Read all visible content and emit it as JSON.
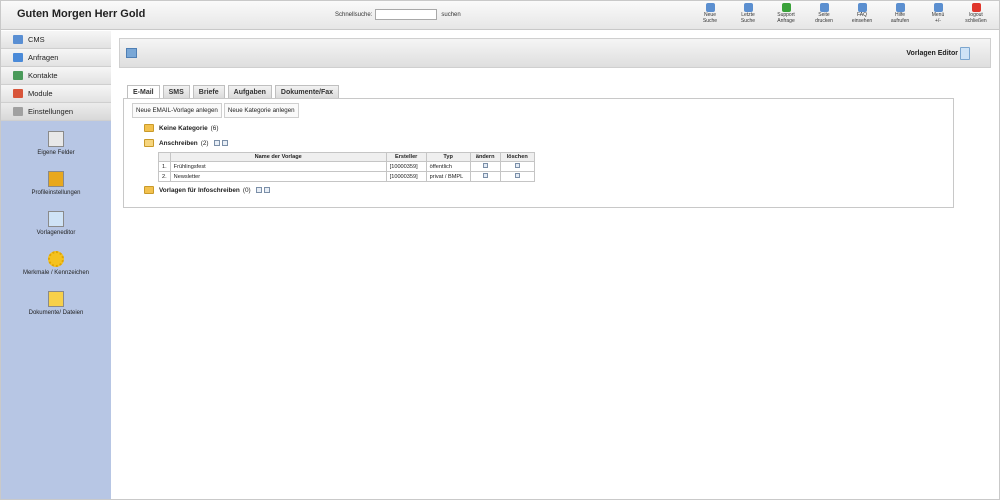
{
  "header": {
    "greeting": "Guten Morgen Herr Gold",
    "search_label": "Schnellsuche:",
    "search_value": "",
    "search_button": "suchen",
    "tools": [
      {
        "label": "Neue\nSuche",
        "icon": "search-icon",
        "color": "#5b8fd0"
      },
      {
        "label": "Letzte\nSuche",
        "icon": "history-icon",
        "color": "#5b8fd0"
      },
      {
        "label": "Support\nAnfrage",
        "icon": "support-plus-icon",
        "color": "#3aa23a"
      },
      {
        "label": "Seite\ndrucken",
        "icon": "printer-icon",
        "color": "#5b8fd0"
      },
      {
        "label": "FAQ\neinsehen",
        "icon": "faq-icon",
        "color": "#5b8fd0"
      },
      {
        "label": "Hilfe\naufrufen",
        "icon": "help-icon",
        "color": "#5b8fd0"
      },
      {
        "label": "Menü\n+/-",
        "icon": "menu-toggle-icon",
        "color": "#5b8fd0"
      },
      {
        "label": "logout\nschließen",
        "icon": "logout-icon",
        "color": "#e0362c"
      }
    ]
  },
  "sidebar": {
    "items": [
      {
        "label": "CMS",
        "icon": "cms-icon",
        "color": "#5a8fd3"
      },
      {
        "label": "Anfragen",
        "icon": "chat-icon",
        "color": "#4a8ad8"
      },
      {
        "label": "Kontakte",
        "icon": "contacts-icon",
        "color": "#4a9a5a"
      },
      {
        "label": "Module",
        "icon": "module-icon",
        "color": "#d8553a"
      },
      {
        "label": "Einstellungen",
        "icon": "settings-icon",
        "color": "#a0a0a0"
      }
    ],
    "sub_items": [
      {
        "label": "Eigene Felder",
        "icon": "fields-icon",
        "color": "#e8e8e8"
      },
      {
        "label": "Profileinstellungen",
        "icon": "profile-book-icon",
        "color": "#e8a81e"
      },
      {
        "label": "Vorlageneditor",
        "icon": "template-editor-icon",
        "color": "#cfe3f6"
      },
      {
        "label": "Merkmale / Kennzeichen",
        "icon": "sun-marker-icon",
        "color": "#f4c21f"
      },
      {
        "label": "Dokumente/ Dateien",
        "icon": "envelope-icon",
        "color": "#f7d04a"
      }
    ]
  },
  "main": {
    "title": "Vorlagen Editor",
    "tabs": [
      "E-Mail",
      "SMS",
      "Briefe",
      "Aufgaben",
      "Dokumente/Fax"
    ],
    "actions": [
      "Neue EMAIL-Vorlage anlegen",
      "Neue Kategorie anlegen"
    ],
    "categories": [
      {
        "name": "Keine Kategorie",
        "count": "(6)"
      },
      {
        "name": "Anschreiben",
        "count": "(2)"
      },
      {
        "name": "Vorlagen für Infoschreiben",
        "count": "(0)"
      }
    ],
    "table": {
      "headers": [
        "",
        "Name der Vorlage",
        "Ersteller",
        "Typ",
        "ändern",
        "löschen"
      ],
      "rows": [
        {
          "num": "1.",
          "name": "Frühlingsfest",
          "creator": "[10000359]",
          "type": "öffentlich"
        },
        {
          "num": "2.",
          "name": "Newsletter",
          "creator": "[10000359]",
          "type": "privat / BMPL"
        }
      ]
    }
  }
}
